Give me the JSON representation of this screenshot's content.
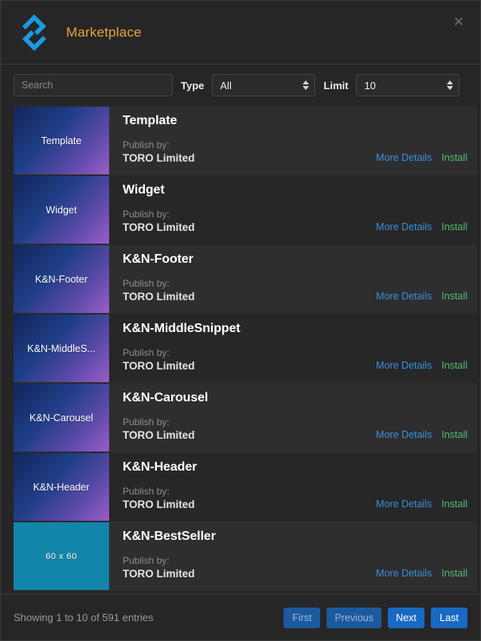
{
  "header": {
    "title": "Marketplace",
    "logo_icon": "marketplace-diamond-logo",
    "close_icon": "✕",
    "accent_color": "#e8a33d"
  },
  "filters": {
    "search": {
      "value": "",
      "placeholder": "Search"
    },
    "type": {
      "label": "Type",
      "value": "All",
      "options": [
        "All"
      ]
    },
    "limit": {
      "label": "Limit",
      "value": "10",
      "options": [
        "10"
      ]
    }
  },
  "list": {
    "publish_label": "Publish by:",
    "more_details_label": "More Details",
    "install_label": "Install",
    "link_color": "#3b8ede",
    "install_color": "#56b86a",
    "items": [
      {
        "title": "Template",
        "thumb_label": "Template",
        "publisher": "TORO Limited",
        "thumb_style": "gradient"
      },
      {
        "title": "Widget",
        "thumb_label": "Widget",
        "publisher": "TORO Limited",
        "thumb_style": "gradient"
      },
      {
        "title": "K&N-Footer",
        "thumb_label": "K&N-Footer",
        "publisher": "TORO Limited",
        "thumb_style": "gradient"
      },
      {
        "title": "K&N-MiddleSnippet",
        "thumb_label": "K&N-MiddleS...",
        "publisher": "TORO Limited",
        "thumb_style": "gradient"
      },
      {
        "title": "K&N-Carousel",
        "thumb_label": "K&N-Carousel",
        "publisher": "TORO Limited",
        "thumb_style": "gradient"
      },
      {
        "title": "K&N-Header",
        "thumb_label": "K&N-Header",
        "publisher": "TORO Limited",
        "thumb_style": "gradient"
      },
      {
        "title": "K&N-BestSeller",
        "thumb_label": "60 x 60",
        "publisher": "TORO Limited",
        "thumb_style": "plain"
      }
    ]
  },
  "footer": {
    "entries_info": "Showing 1 to 10 of 591 entries",
    "buttons": [
      {
        "label": "First",
        "state": "disabled"
      },
      {
        "label": "Previous",
        "state": "disabled"
      },
      {
        "label": "Next",
        "state": "active"
      },
      {
        "label": "Last",
        "state": "active"
      }
    ]
  }
}
